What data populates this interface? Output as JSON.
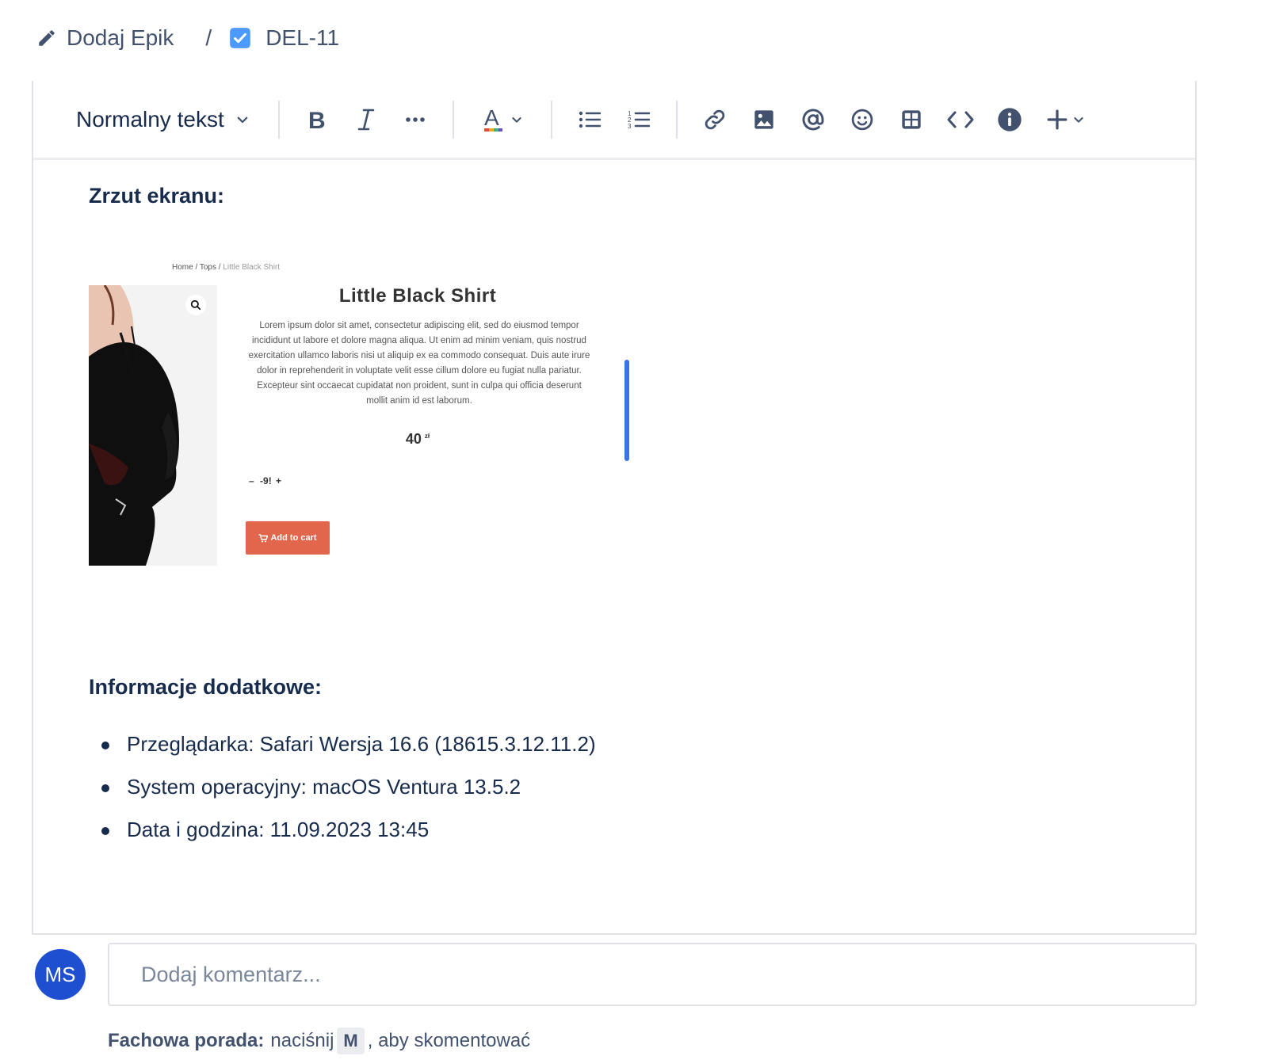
{
  "breadcrumb": {
    "epic_label": "Dodaj Epik",
    "separator": "/",
    "issue_key": "DEL-11"
  },
  "toolbar": {
    "text_style": "Normalny tekst",
    "icons": [
      "bold-icon",
      "italic-icon",
      "more-icon",
      "text-color-icon",
      "bullet-list-icon",
      "numbered-list-icon",
      "link-icon",
      "image-icon",
      "mention-icon",
      "emoji-icon",
      "table-icon",
      "code-icon",
      "info-icon",
      "insert-icon"
    ]
  },
  "content": {
    "screenshot_heading": "Zrzut ekranu:",
    "screenshot": {
      "breadcrumb_home": "Home",
      "breadcrumb_sep": "/",
      "breadcrumb_cat": "Tops",
      "breadcrumb_current": "Little Black Shirt",
      "title": "Little Black Shirt",
      "description": "Lorem ipsum dolor sit amet, consectetur adipiscing elit, sed do eiusmod tempor incididunt ut labore et dolore magna aliqua. Ut enim ad minim veniam, quis nostrud exercitation ullamco laboris nisi ut aliquip ex ea commodo consequat. Duis aute irure dolor in reprehenderit in voluptate velit esse cillum dolore eu fugiat nulla pariatur. Excepteur sint occaecat cupidatat non proident, sunt in culpa qui officia deserunt mollit anim id est laborum.",
      "price": "40",
      "currency": "zł",
      "qty_minus": "–",
      "qty_value": "-9!",
      "qty_plus": "+",
      "add_to_cart": "Add to cart"
    },
    "info_heading": "Informacje dodatkowe:",
    "info_items": [
      "Przeglądarka: Safari Wersja 16.6 (18615.3.12.11.2)",
      "System operacyjny: macOS Ventura 13.5.2",
      "Data i godzina: 11.09.2023 13:45"
    ]
  },
  "comment": {
    "avatar_initials": "MS",
    "placeholder": "Dodaj komentarz...",
    "tip_label": "Fachowa porada:",
    "tip_pre": "naciśnij",
    "tip_key": "M",
    "tip_post": ", aby skomentować"
  },
  "colors": {
    "text": "#172b4d",
    "avatar": "#1f4fd1",
    "checkbox": "#4c9aff",
    "cart_button": "#e2664c",
    "accent_bar": "#3b73e8"
  }
}
